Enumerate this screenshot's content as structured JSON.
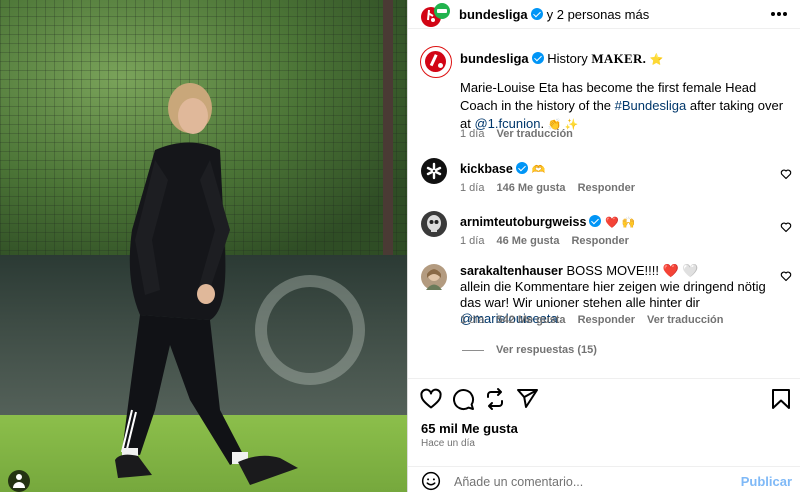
{
  "header": {
    "username": "bundesliga",
    "collab_text": "y 2 personas más"
  },
  "caption": {
    "username": "bundesliga",
    "title_plain": "History",
    "title_brand": "MAKER.",
    "title_emoji": "⭐",
    "text_1": "Marie-Louise Eta has become the first female Head Coach in the history of the",
    "hashtag": "#Bundesliga",
    "text_2": "after taking over at",
    "mention": "@1.fcunion",
    "text_3": ".",
    "end_emojis": "👏 ✨",
    "time": "1 día",
    "translate": "Ver traducción"
  },
  "comments": [
    {
      "username": "kickbase",
      "text": "",
      "emoji": "🫶",
      "time": "1 día",
      "likes": "146 Me gusta",
      "reply": "Responder"
    },
    {
      "username": "arnimteutoburgweiss",
      "text": "",
      "emoji": "❤️ 🙌",
      "time": "1 día",
      "likes": "46 Me gusta",
      "reply": "Responder"
    },
    {
      "username": "sarakaltenhauser",
      "text": "BOSS MOVE!!!! ❤️ 🤍",
      "text_2": "allein die Kommentare hier zeigen wie dringend nötig das war! Wir unioner stehen alle hinter dir",
      "mention": "@marielouiseeta",
      "time": "1 día",
      "likes": "542 Me gusta",
      "reply": "Responder",
      "translate": "Ver traducción"
    }
  ],
  "view_replies": "Ver respuestas (15)",
  "post": {
    "likes": "65 mil Me gusta",
    "time_ago": "Hace un día"
  },
  "add_comment": {
    "placeholder": "Añade un comentario...",
    "publish": "Publicar"
  },
  "colors": {
    "link": "#00376b",
    "verified": "#0095f6",
    "brand_red": "#d20515",
    "publish_disabled": "#7fb9f7",
    "like_red": "#ff3040"
  },
  "icons": [
    "like-icon",
    "comment-icon",
    "share-icon",
    "send-icon",
    "save-icon",
    "more-icon",
    "emoji-icon",
    "verified-icon",
    "user-tag-icon"
  ]
}
